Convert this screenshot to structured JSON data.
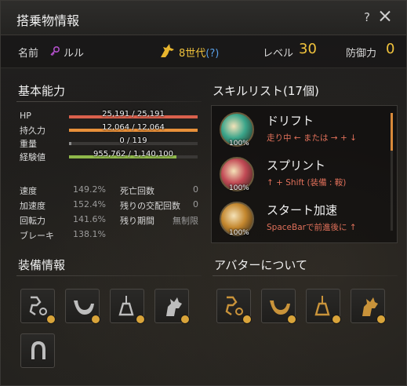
{
  "window": {
    "title": "搭乗物情報",
    "help": "?"
  },
  "info": {
    "name_label": "名前",
    "name": "ルル",
    "generation": "8世代",
    "generation_help": "(?)",
    "level_label": "レベル",
    "level": "30",
    "defense_label": "防御力",
    "defense": "0"
  },
  "basic": {
    "title": "基本能力",
    "bars": [
      {
        "name": "HP",
        "text": "25,191 / 25,191",
        "fraction": 1.0,
        "color": "#d9604c"
      },
      {
        "name": "持久力",
        "text": "12,064 / 12,064",
        "fraction": 1.0,
        "color": "#e8903a"
      },
      {
        "name": "重量",
        "text": "0 / 119",
        "fraction": 0.02,
        "color": "#8c8c8c"
      },
      {
        "name": "経験値",
        "text": "955,762 / 1,140,100",
        "fraction": 0.838,
        "color": "#8fb84a"
      }
    ],
    "stats_left": [
      {
        "name": "速度",
        "value": "149.2%"
      },
      {
        "name": "加速度",
        "value": "152.4%"
      },
      {
        "name": "回転力",
        "value": "141.6%"
      },
      {
        "name": "ブレーキ",
        "value": "138.1%"
      }
    ],
    "stats_right": [
      {
        "name": "死亡回数",
        "value": "0"
      },
      {
        "name": "残りの交配回数",
        "value": "0"
      },
      {
        "name": "残り期間",
        "value": "無制限"
      }
    ]
  },
  "skills": {
    "title": "スキルリスト(17個)",
    "items": [
      {
        "name": "ドリフト",
        "command": "走り中 ← または → + ↓",
        "percent": "100%",
        "color": "#3aa58a"
      },
      {
        "name": "スプリント",
        "command": "↑ + Shift (装備 : 鞍)",
        "percent": "100%",
        "color": "#c24a55"
      },
      {
        "name": "スタート加速",
        "command": "SpaceBarで前進後に ↑",
        "percent": "100%",
        "color": "#c4872e"
      }
    ]
  },
  "equipment": {
    "title": "装備情報",
    "slots": [
      "bridle-icon",
      "saddle-icon",
      "stirrup-icon",
      "barding-icon",
      "horseshoe-icon"
    ]
  },
  "avatar": {
    "title": "アバターについて",
    "slots": [
      "bridle-icon",
      "saddle-icon",
      "stirrup-icon",
      "barding-icon"
    ]
  },
  "colors": {
    "accent": "#f0c23c",
    "command": "#e0705a",
    "link": "#5aa0e8"
  }
}
